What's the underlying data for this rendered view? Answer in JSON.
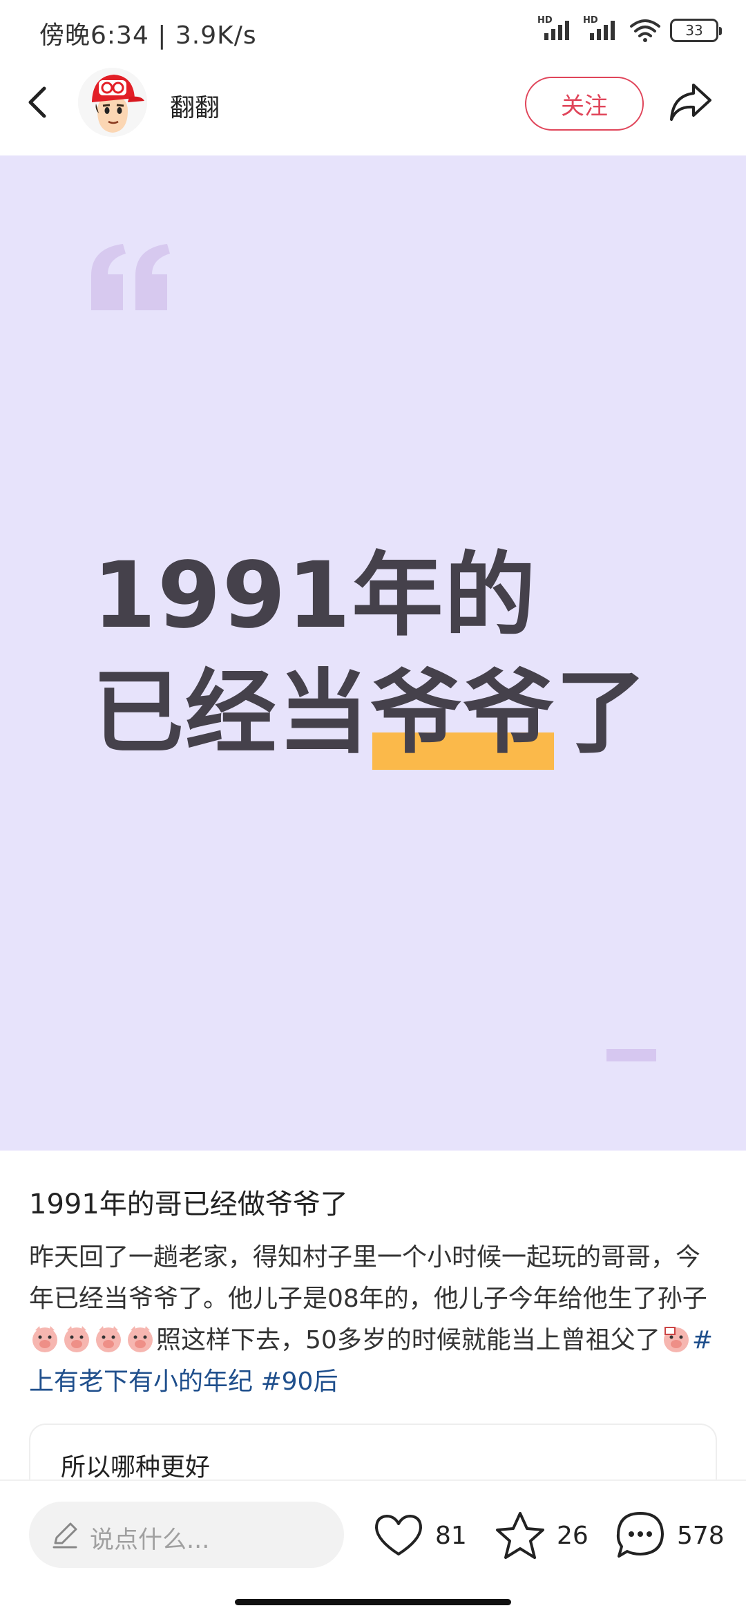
{
  "status_bar": {
    "time_speed": "傍晚6:34 | 3.9K/s",
    "sim1_label": "HD",
    "sim2_label": "HD",
    "battery": "33"
  },
  "header": {
    "author_name": "翻翻",
    "follow_label": "关注"
  },
  "cover": {
    "background_color": "#e7e3fb",
    "line1": "1991年的",
    "line2_prefix": "已经当",
    "line2_highlight": "爷爷",
    "line2_suffix": "了",
    "highlight_color": "#fbb94a"
  },
  "post": {
    "title": "1991年的哥已经做爷爷了",
    "body_part1": "昨天回了一趟老家，得知村子里一个小时候一起玩的哥哥，今年已经当爷爷了。他儿子是08年的，他儿子今年给他生了孙子",
    "body_part2": "照这样下去，50多岁的时候就能当上曾祖父了",
    "tag1": "#上有老下有小的年纪",
    "tag2": "#90后",
    "emojis": [
      "pig-emoji",
      "pig-emoji",
      "pig-emoji",
      "pig-emoji",
      "pig-emoji"
    ]
  },
  "poll": {
    "title": "所以哪种更好"
  },
  "bottom_bar": {
    "comment_placeholder": "说点什么...",
    "like_count": "81",
    "star_count": "26",
    "comment_count": "578"
  },
  "icons": [
    "back-icon",
    "share-icon",
    "pen-icon",
    "heart-icon",
    "star-icon",
    "comment-icon",
    "quote-icon"
  ]
}
